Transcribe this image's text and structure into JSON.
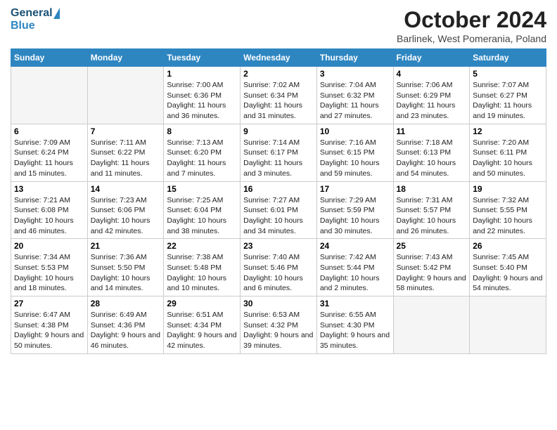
{
  "header": {
    "logo_line1": "General",
    "logo_line2": "Blue",
    "month_title": "October 2024",
    "location": "Barlinek, West Pomerania, Poland"
  },
  "weekdays": [
    "Sunday",
    "Monday",
    "Tuesday",
    "Wednesday",
    "Thursday",
    "Friday",
    "Saturday"
  ],
  "weeks": [
    [
      {
        "day": "",
        "info": ""
      },
      {
        "day": "",
        "info": ""
      },
      {
        "day": "1",
        "info": "Sunrise: 7:00 AM\nSunset: 6:36 PM\nDaylight: 11 hours and 36 minutes."
      },
      {
        "day": "2",
        "info": "Sunrise: 7:02 AM\nSunset: 6:34 PM\nDaylight: 11 hours and 31 minutes."
      },
      {
        "day": "3",
        "info": "Sunrise: 7:04 AM\nSunset: 6:32 PM\nDaylight: 11 hours and 27 minutes."
      },
      {
        "day": "4",
        "info": "Sunrise: 7:06 AM\nSunset: 6:29 PM\nDaylight: 11 hours and 23 minutes."
      },
      {
        "day": "5",
        "info": "Sunrise: 7:07 AM\nSunset: 6:27 PM\nDaylight: 11 hours and 19 minutes."
      }
    ],
    [
      {
        "day": "6",
        "info": "Sunrise: 7:09 AM\nSunset: 6:24 PM\nDaylight: 11 hours and 15 minutes."
      },
      {
        "day": "7",
        "info": "Sunrise: 7:11 AM\nSunset: 6:22 PM\nDaylight: 11 hours and 11 minutes."
      },
      {
        "day": "8",
        "info": "Sunrise: 7:13 AM\nSunset: 6:20 PM\nDaylight: 11 hours and 7 minutes."
      },
      {
        "day": "9",
        "info": "Sunrise: 7:14 AM\nSunset: 6:17 PM\nDaylight: 11 hours and 3 minutes."
      },
      {
        "day": "10",
        "info": "Sunrise: 7:16 AM\nSunset: 6:15 PM\nDaylight: 10 hours and 59 minutes."
      },
      {
        "day": "11",
        "info": "Sunrise: 7:18 AM\nSunset: 6:13 PM\nDaylight: 10 hours and 54 minutes."
      },
      {
        "day": "12",
        "info": "Sunrise: 7:20 AM\nSunset: 6:11 PM\nDaylight: 10 hours and 50 minutes."
      }
    ],
    [
      {
        "day": "13",
        "info": "Sunrise: 7:21 AM\nSunset: 6:08 PM\nDaylight: 10 hours and 46 minutes."
      },
      {
        "day": "14",
        "info": "Sunrise: 7:23 AM\nSunset: 6:06 PM\nDaylight: 10 hours and 42 minutes."
      },
      {
        "day": "15",
        "info": "Sunrise: 7:25 AM\nSunset: 6:04 PM\nDaylight: 10 hours and 38 minutes."
      },
      {
        "day": "16",
        "info": "Sunrise: 7:27 AM\nSunset: 6:01 PM\nDaylight: 10 hours and 34 minutes."
      },
      {
        "day": "17",
        "info": "Sunrise: 7:29 AM\nSunset: 5:59 PM\nDaylight: 10 hours and 30 minutes."
      },
      {
        "day": "18",
        "info": "Sunrise: 7:31 AM\nSunset: 5:57 PM\nDaylight: 10 hours and 26 minutes."
      },
      {
        "day": "19",
        "info": "Sunrise: 7:32 AM\nSunset: 5:55 PM\nDaylight: 10 hours and 22 minutes."
      }
    ],
    [
      {
        "day": "20",
        "info": "Sunrise: 7:34 AM\nSunset: 5:53 PM\nDaylight: 10 hours and 18 minutes."
      },
      {
        "day": "21",
        "info": "Sunrise: 7:36 AM\nSunset: 5:50 PM\nDaylight: 10 hours and 14 minutes."
      },
      {
        "day": "22",
        "info": "Sunrise: 7:38 AM\nSunset: 5:48 PM\nDaylight: 10 hours and 10 minutes."
      },
      {
        "day": "23",
        "info": "Sunrise: 7:40 AM\nSunset: 5:46 PM\nDaylight: 10 hours and 6 minutes."
      },
      {
        "day": "24",
        "info": "Sunrise: 7:42 AM\nSunset: 5:44 PM\nDaylight: 10 hours and 2 minutes."
      },
      {
        "day": "25",
        "info": "Sunrise: 7:43 AM\nSunset: 5:42 PM\nDaylight: 9 hours and 58 minutes."
      },
      {
        "day": "26",
        "info": "Sunrise: 7:45 AM\nSunset: 5:40 PM\nDaylight: 9 hours and 54 minutes."
      }
    ],
    [
      {
        "day": "27",
        "info": "Sunrise: 6:47 AM\nSunset: 4:38 PM\nDaylight: 9 hours and 50 minutes."
      },
      {
        "day": "28",
        "info": "Sunrise: 6:49 AM\nSunset: 4:36 PM\nDaylight: 9 hours and 46 minutes."
      },
      {
        "day": "29",
        "info": "Sunrise: 6:51 AM\nSunset: 4:34 PM\nDaylight: 9 hours and 42 minutes."
      },
      {
        "day": "30",
        "info": "Sunrise: 6:53 AM\nSunset: 4:32 PM\nDaylight: 9 hours and 39 minutes."
      },
      {
        "day": "31",
        "info": "Sunrise: 6:55 AM\nSunset: 4:30 PM\nDaylight: 9 hours and 35 minutes."
      },
      {
        "day": "",
        "info": ""
      },
      {
        "day": "",
        "info": ""
      }
    ]
  ]
}
